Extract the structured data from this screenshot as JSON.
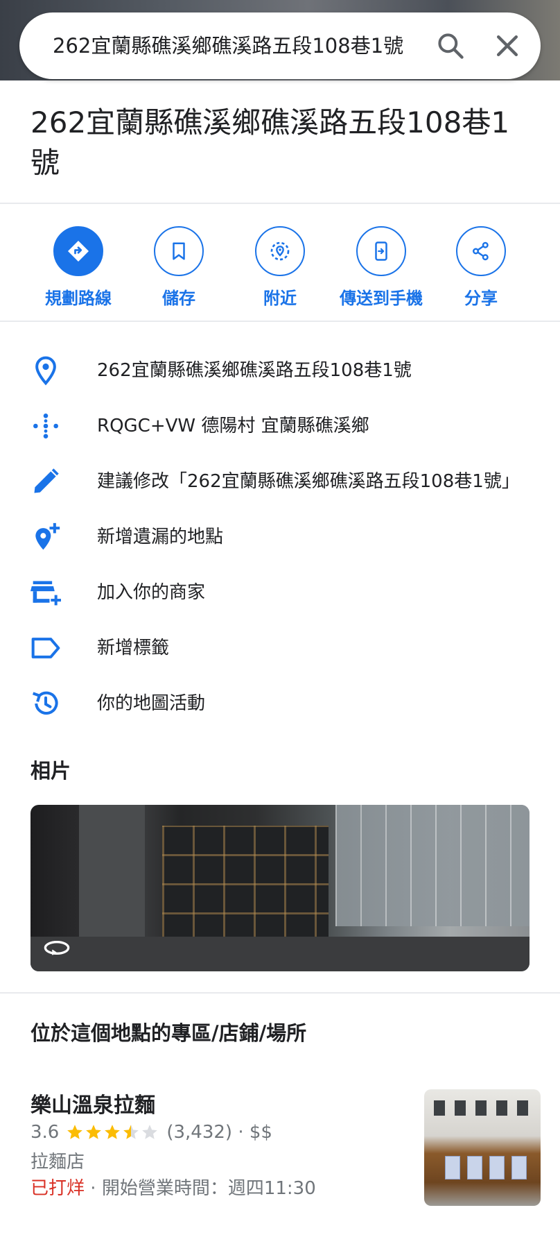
{
  "search": {
    "query": "262宜蘭縣礁溪鄉礁溪路五段108巷1號"
  },
  "place": {
    "title": "262宜蘭縣礁溪鄉礁溪路五段108巷1號"
  },
  "actions": [
    {
      "label": "規劃路線",
      "icon": "directions-icon"
    },
    {
      "label": "儲存",
      "icon": "bookmark-icon"
    },
    {
      "label": "附近",
      "icon": "nearby-icon"
    },
    {
      "label": "傳送到手機",
      "icon": "send-to-phone-icon"
    },
    {
      "label": "分享",
      "icon": "share-icon"
    }
  ],
  "info": {
    "address": "262宜蘭縣礁溪鄉礁溪路五段108巷1號",
    "plus_code": "RQGC+VW 德陽村 宜蘭縣礁溪鄉",
    "suggest_edit": "建議修改「262宜蘭縣礁溪鄉礁溪路五段108巷1號」",
    "add_missing_place": "新增遺漏的地點",
    "add_business": "加入你的商家",
    "add_label": "新增標籤",
    "maps_activity": "你的地圖活動"
  },
  "photos": {
    "heading": "相片"
  },
  "places_here": {
    "heading": "位於這個地點的專區/店鋪/場所",
    "items": [
      {
        "name": "樂山溫泉拉麵",
        "rating": "3.6",
        "rating_value": 3.6,
        "reviews": "(3,432)",
        "price": "$$",
        "category": "拉麵店",
        "status": "已打烊",
        "separator": " · ",
        "hours": "開始營業時間：週四11:30"
      }
    ]
  },
  "colors": {
    "accent": "#1a73e8",
    "star": "#fbbc04",
    "closed": "#d93025",
    "secondary_text": "#70757a"
  }
}
